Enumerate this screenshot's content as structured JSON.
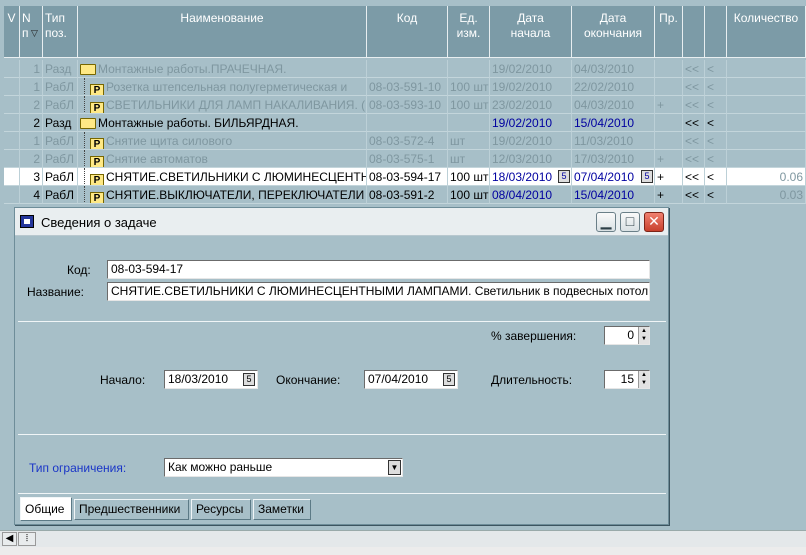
{
  "grid": {
    "headers": {
      "v": "V",
      "n": "N\nп",
      "type": "Тип\nпоз.",
      "name": "Наименование",
      "code": "Код",
      "unit": "Ед.\nизм.",
      "start": "Дата\nначала",
      "end": "Дата\nокончания",
      "pr": "Пр.",
      "qty": "Количество"
    },
    "rows": [
      {
        "n": "1",
        "type": "Разд",
        "name": "Монтажные работы.ПРАЧЕЧНАЯ.",
        "code": "",
        "unit": "",
        "start": "19/02/2010",
        "end": "04/03/2010",
        "pr": "",
        "l1": "<<",
        "l2": "<",
        "qty": ""
      },
      {
        "n": "1",
        "type": "РабЛ",
        "name": "Розетка штепсельная полугерметическая и",
        "code": "08-03-591-10",
        "unit": "100 шт",
        "start": "19/02/2010",
        "end": "22/02/2010",
        "pr": "",
        "l1": "<<",
        "l2": "<",
        "qty": ""
      },
      {
        "n": "2",
        "type": "РабЛ",
        "name": "СВЕТИЛЬНИКИ ДЛЯ ЛАМП НАКАЛИВАНИЯ. (",
        "code": "08-03-593-10",
        "unit": "100 шт",
        "start": "23/02/2010",
        "end": "04/03/2010",
        "pr": "+",
        "l1": "<<",
        "l2": "<",
        "qty": ""
      },
      {
        "n": "2",
        "type": "Разд",
        "name": "Монтажные работы. БИЛЬЯРДНАЯ.",
        "code": "",
        "unit": "",
        "start": "19/02/2010",
        "end": "15/04/2010",
        "pr": "",
        "l1": "<<",
        "l2": "<",
        "qty": ""
      },
      {
        "n": "1",
        "type": "РабЛ",
        "name": "Снятие  щита силового",
        "code": "08-03-572-4",
        "unit": "шт",
        "start": "19/02/2010",
        "end": "11/03/2010",
        "pr": "",
        "l1": "<<",
        "l2": "<",
        "qty": ""
      },
      {
        "n": "2",
        "type": "РабЛ",
        "name": "Снятие автоматов",
        "code": "08-03-575-1",
        "unit": "шт",
        "start": "12/03/2010",
        "end": "17/03/2010",
        "pr": "+",
        "l1": "<<",
        "l2": "<",
        "qty": ""
      },
      {
        "n": "3",
        "type": "РабЛ",
        "name": "СНЯТИЕ.СВЕТИЛЬНИКИ С ЛЮМИНЕСЦЕНТНЫ",
        "code": "08-03-594-17",
        "unit": "100 шт",
        "start": "18/03/2010",
        "end": "07/04/2010",
        "pr": "+",
        "l1": "<<",
        "l2": "<",
        "qty": "0.06"
      },
      {
        "n": "4",
        "type": "РабЛ",
        "name": "СНЯТИЕ.ВЫКЛЮЧАТЕЛИ, ПЕРЕКЛЮЧАТЕЛИ",
        "code": "08-03-591-2",
        "unit": "100 шт",
        "start": "08/04/2010",
        "end": "15/04/2010",
        "pr": "+",
        "l1": "<<",
        "l2": "<",
        "qty": "0.03"
      }
    ]
  },
  "dialog": {
    "title": "Сведения о задаче",
    "code_label": "Код:",
    "code_value": "08-03-594-17",
    "name_label": "Название:",
    "name_value": "СНЯТИЕ.СВЕТИЛЬНИКИ С ЛЮМИНЕСЦЕНТНЫМИ ЛАМПАМИ. Светильник в подвесных потол",
    "completion_label": "% завершения:",
    "completion_value": "0",
    "start_label": "Начало:",
    "start_value": "18/03/2010",
    "end_label": "Окончание:",
    "end_value": "07/04/2010",
    "duration_label": "Длительность:",
    "duration_value": "15",
    "constraint_label": "Тип ограничения:",
    "constraint_value": "Как можно раньше",
    "tabs": [
      "Общие",
      "Предшественники",
      "Ресурсы",
      "Заметки"
    ]
  },
  "colors": {
    "background": "#a7bfc8",
    "header": "#7c9ba7",
    "accent_blue": "#1a35c7"
  }
}
